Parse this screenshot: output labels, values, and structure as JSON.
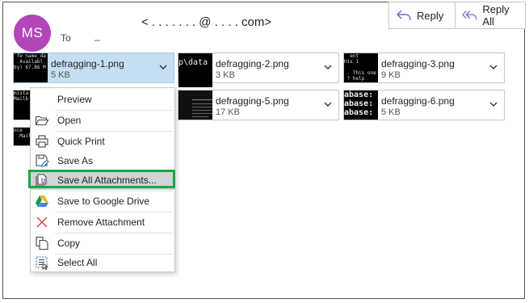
{
  "sender": {
    "initials": "MS",
    "address": "<  .  .  .  .  .  .  . @ .  .  .  . com>",
    "to_label": "To",
    "to_value": "_"
  },
  "reply": {
    "reply_label": "Reply",
    "reply_all_label": "Reply All"
  },
  "attachments": [
    {
      "name": "defragging-1.png",
      "size": "5 KB",
      "selected": true
    },
    {
      "name": "defragging-2.png",
      "size": "3 KB"
    },
    {
      "name": "defragging-3.png",
      "size": "9 KB"
    },
    {
      "name": "defragging-5.png",
      "size": "17 KB"
    },
    {
      "name": "defragging-6.png",
      "size": "5 KB"
    }
  ],
  "thumbnails": {
    "t1": "'fe name_da\n  Availabl\nby) 67.86 M",
    "t2": "p\\data",
    "t3": "  ent\nHis 1\n\n . This one\n ? help",
    "t4": "mista\nMailb",
    "t5": "",
    "t6": "abase:\nabase:\nabase:",
    "t7": "nce\n  Mail"
  },
  "context_menu": {
    "items": [
      {
        "label": "Preview",
        "icon": "none"
      },
      {
        "label": "Open",
        "icon": "folder-open-icon"
      },
      {
        "label": "Quick Print",
        "icon": "printer-icon"
      },
      {
        "label": "Save As",
        "icon": "save-as-icon"
      },
      {
        "label": "Save All Attachments...",
        "icon": "save-all-icon"
      },
      {
        "label": "Save to Google Drive",
        "icon": "google-drive-icon"
      },
      {
        "label": "Remove Attachment",
        "icon": "remove-x-icon"
      },
      {
        "label": "Copy",
        "icon": "copy-icon"
      },
      {
        "label": "Select All",
        "icon": "select-all-icon"
      }
    ],
    "highlighted_index": 4
  },
  "colors": {
    "avatar": "#b147b8",
    "selected_attachment": "#c4dff3",
    "highlight_border": "#1fa64a",
    "reply_arrow": "#8a5cc8",
    "remove_x": "#e0463c"
  }
}
